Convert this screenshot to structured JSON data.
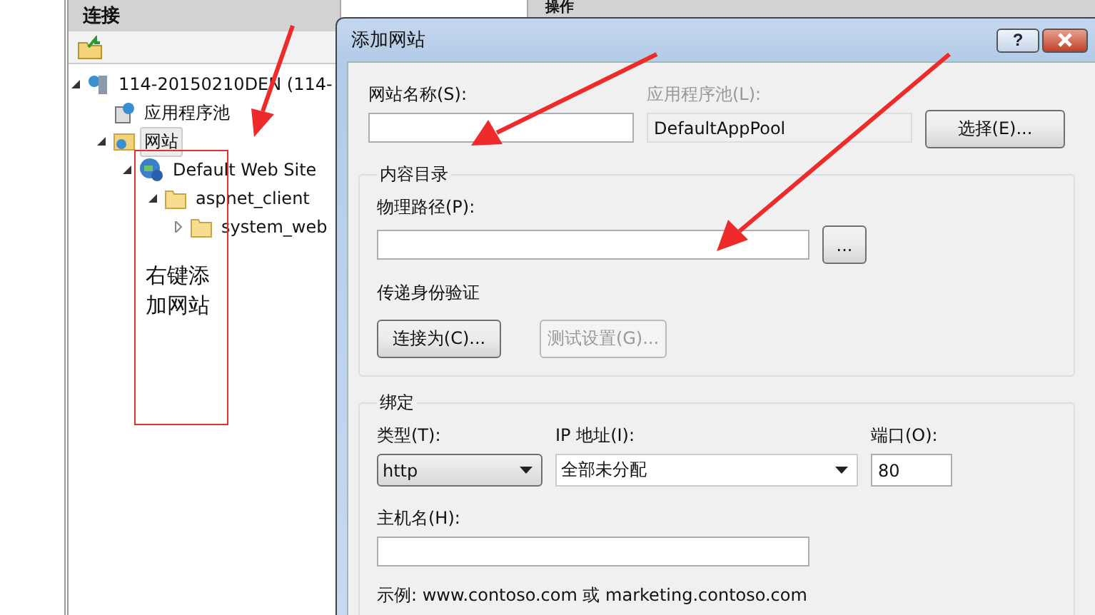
{
  "left_panel": {
    "title": "连接",
    "tree": [
      {
        "label": "114-20150210DEN (114-",
        "kind": "server",
        "expanded": true,
        "selected": false,
        "children": [
          {
            "label": "应用程序池",
            "kind": "pool",
            "selected": false
          },
          {
            "label": "网站",
            "kind": "sites",
            "expanded": true,
            "selected": true,
            "children": [
              {
                "label": "Default Web Site",
                "kind": "globe",
                "expanded": true,
                "selected": false,
                "children": [
                  {
                    "label": "aspnet_client",
                    "kind": "folder",
                    "expanded": true,
                    "selected": false,
                    "children": [
                      {
                        "label": "system_web",
                        "kind": "folder",
                        "expanded": false,
                        "selected": false
                      }
                    ]
                  }
                ]
              }
            ]
          }
        ]
      }
    ]
  },
  "right_panel": {
    "title": "操作"
  },
  "dialog": {
    "title": "添加网站",
    "help": "?",
    "site_name": {
      "label": "网站名称(S):"
    },
    "app_pool": {
      "label": "应用程序池(L):",
      "value": "DefaultAppPool",
      "disabled": true,
      "button": "选择(E)..."
    },
    "content_directory": {
      "title": "内容目录",
      "path_label": "物理路径(P):",
      "browse": "...",
      "auth_label": "传递身份验证",
      "buttons": [
        {
          "label": "连接为(C)...",
          "disabled": false
        },
        {
          "label": "测试设置(G)...",
          "disabled": true
        }
      ]
    },
    "binding": {
      "title": "绑定",
      "type_label": "类型(T):",
      "type_value": "http",
      "ip_label": "IP 地址(I):",
      "ip_value": "全部未分配",
      "port_label": "端口(O):",
      "port_value": "80",
      "host_label": "主机名(H):",
      "example": "示例: www.contoso.com 或 marketing.contoso.com"
    }
  },
  "annotation": {
    "note": "右键添加网站"
  }
}
